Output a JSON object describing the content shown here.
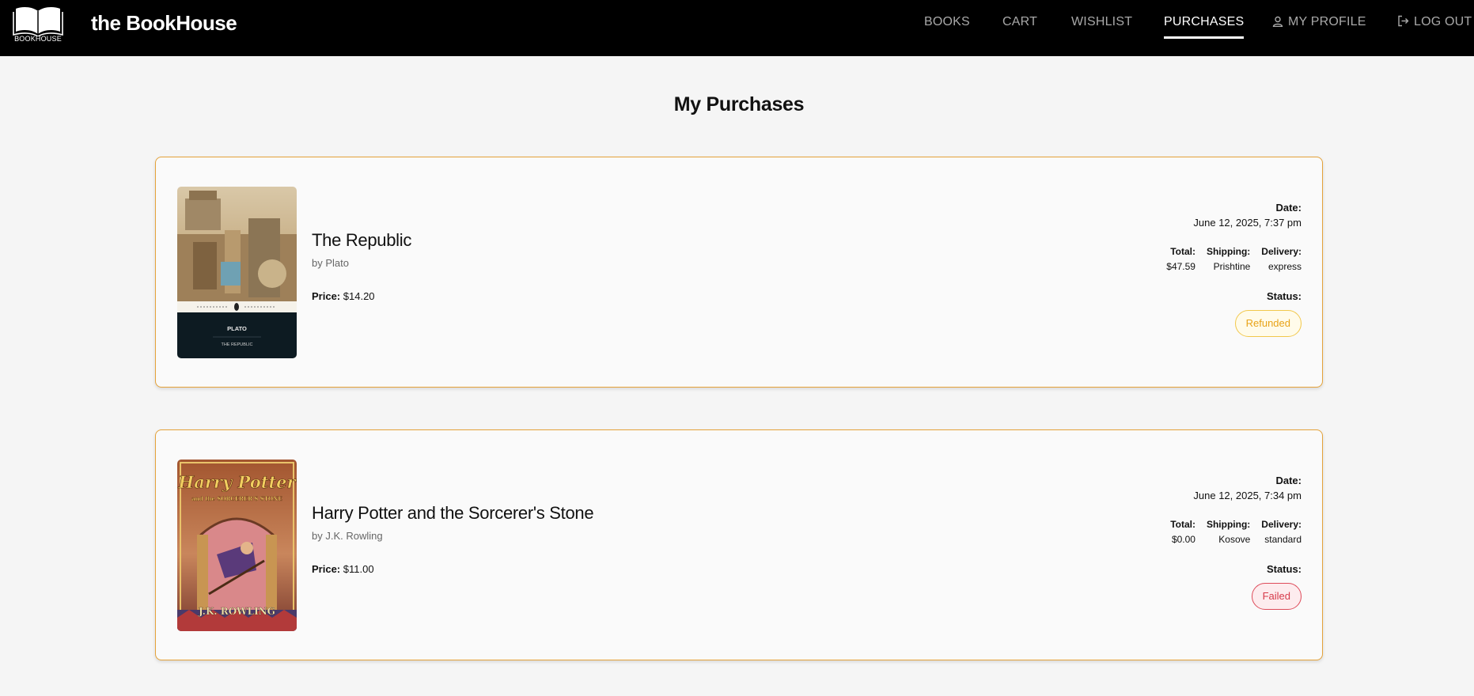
{
  "header": {
    "logo_text": "BOOKHOUSE",
    "brand": "the BookHouse",
    "nav": {
      "books": "BOOKS",
      "cart": "CART",
      "wishlist": "WISHLIST",
      "purchases": "PURCHASES",
      "profile": "MY PROFILE",
      "logout": "LOG OUT"
    },
    "active_nav": "purchases"
  },
  "page_title": "My Purchases",
  "purchases": [
    {
      "title": "The Republic",
      "author": "by Plato",
      "price_label": "Price:",
      "price": "$14.20",
      "cover_author": "PLATO",
      "cover_title": "THE REPUBLIC",
      "date_label": "Date:",
      "date": "June 12, 2025, 7:37 pm",
      "total_label": "Total:",
      "total": "$47.59",
      "shipping_label": "Shipping:",
      "shipping": "Prishtine",
      "delivery_label": "Delivery:",
      "delivery": "express",
      "status_label": "Status:",
      "status": "Refunded"
    },
    {
      "title": "Harry Potter and the Sorcerer's Stone",
      "author": "by J.K. Rowling",
      "price_label": "Price:",
      "price": "$11.00",
      "cover_title": "Harry Potter",
      "cover_subtitle": "and the SORCERER'S STONE",
      "cover_author": "J.K. ROWLING",
      "date_label": "Date:",
      "date": "June 12, 2025, 7:34 pm",
      "total_label": "Total:",
      "total": "$0.00",
      "shipping_label": "Shipping:",
      "shipping": "Kosove",
      "delivery_label": "Delivery:",
      "delivery": "standard",
      "status_label": "Status:",
      "status": "Failed"
    }
  ],
  "colors": {
    "card_border": "#e5a33a",
    "refunded": "#e8a317",
    "failed": "#d63a4a"
  }
}
